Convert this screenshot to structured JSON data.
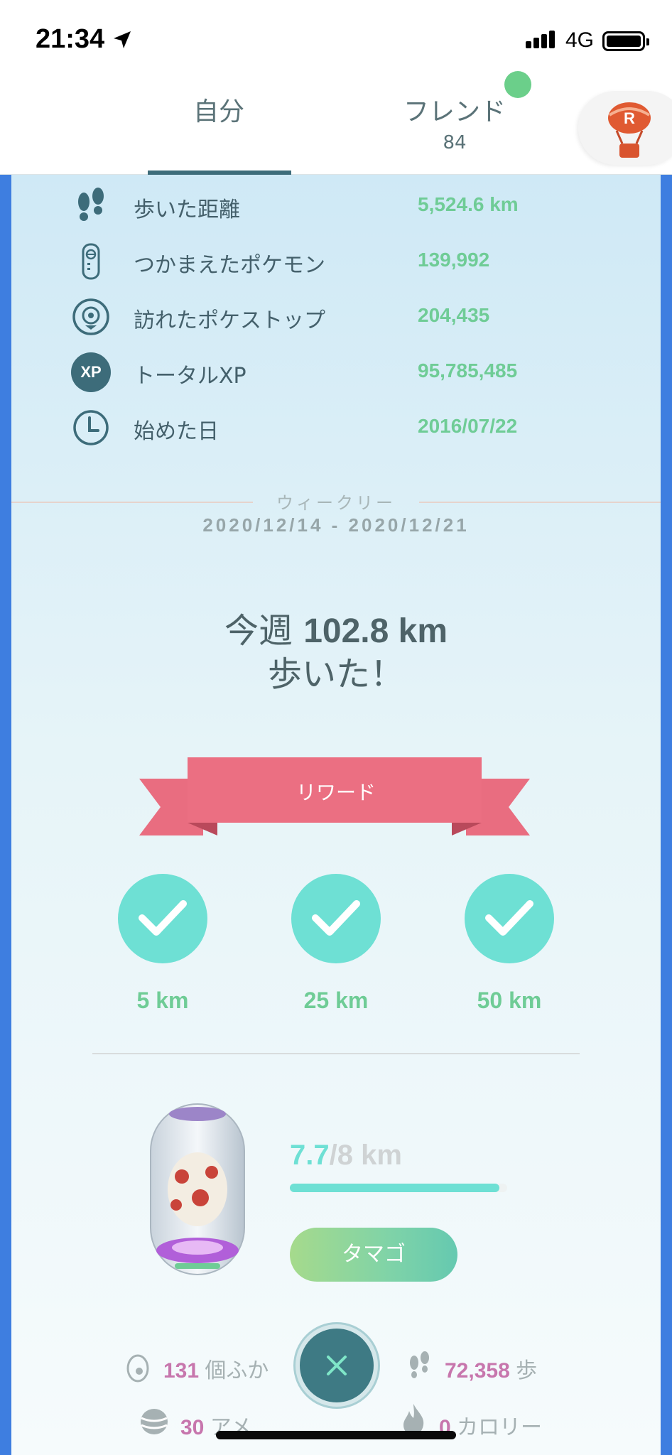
{
  "status_bar": {
    "time": "21:34",
    "network": "4G"
  },
  "tabs": {
    "self": "自分",
    "friend": "フレンド",
    "friend_count": "84"
  },
  "stats": [
    {
      "icon": "footprints-icon",
      "label": "歩いた距離",
      "value": "5,524.6 km"
    },
    {
      "icon": "pokedex-icon",
      "label": "つかまえたポケモン",
      "value": "139,992"
    },
    {
      "icon": "pokestop-icon",
      "label": "訪れたポケストップ",
      "value": "204,435"
    },
    {
      "icon": "xp-icon",
      "label": "トータルXP",
      "value": "95,785,485",
      "icon_text": "XP"
    },
    {
      "icon": "clock-icon",
      "label": "始めた日",
      "value": "2016/07/22"
    }
  ],
  "weekly": {
    "title": "ウィークリー",
    "range": "2020/12/14 - 2020/12/21",
    "walked_prefix": "今週 ",
    "walked_distance": "102.8 km",
    "walked_suffix": "歩いた！"
  },
  "rewards": {
    "title": "リワード",
    "milestones": [
      {
        "label": "5 km",
        "completed": true
      },
      {
        "label": "25 km",
        "completed": true
      },
      {
        "label": "50 km",
        "completed": true
      }
    ]
  },
  "egg": {
    "current": "7.7",
    "total": "/8 km",
    "progress_fraction": 0.9625,
    "button_label": "タマゴ"
  },
  "footer_stats": {
    "hatched_num": "131",
    "hatched_unit": " 個ふか",
    "steps_num": "72,358",
    "steps_unit": " 歩",
    "candy_num": "30",
    "candy_unit": " アメ",
    "calories_num": "0",
    "calories_unit": " カロリー"
  },
  "colors": {
    "accent_green": "#6fcc96",
    "teal": "#6ee0d4",
    "ribbon_pink": "#e96d80",
    "pink_number": "#c776ad"
  }
}
